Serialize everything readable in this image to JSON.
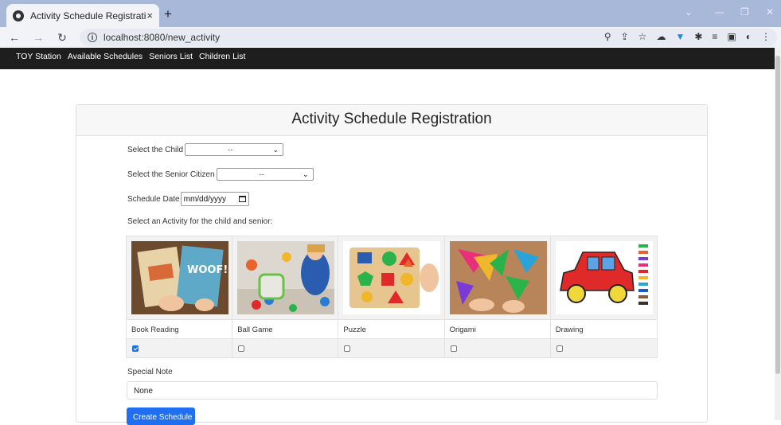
{
  "browser": {
    "tab_title": "Activity Schedule Registration",
    "tab_close": "×",
    "new_tab": "+",
    "url": "localhost:8080/new_activity"
  },
  "app_nav": {
    "items": [
      "TOY Station",
      "Available Schedules",
      "Seniors List",
      "Children List"
    ]
  },
  "form": {
    "heading": "Activity Schedule Registration",
    "child_label": "Select the Child",
    "child_value": "--",
    "senior_label": "Select the Senior Citizen",
    "senior_value": "--",
    "date_label": "Schedule Date",
    "date_placeholder": "mm/dd/yyyy",
    "activity_prompt": "Select an Activity for the child and senior:",
    "activities": [
      {
        "name": "Book Reading",
        "checked": true
      },
      {
        "name": "Ball Game",
        "checked": false
      },
      {
        "name": "Puzzle",
        "checked": false
      },
      {
        "name": "Origami",
        "checked": false
      },
      {
        "name": "Drawing",
        "checked": false
      }
    ],
    "note_label": "Special Note",
    "note_value": "None",
    "submit_label": "Create Schedule"
  },
  "colors": {
    "primary": "#1f6ff0",
    "navbar": "#1e1e1e",
    "tabbar": "#a8b8d8"
  }
}
